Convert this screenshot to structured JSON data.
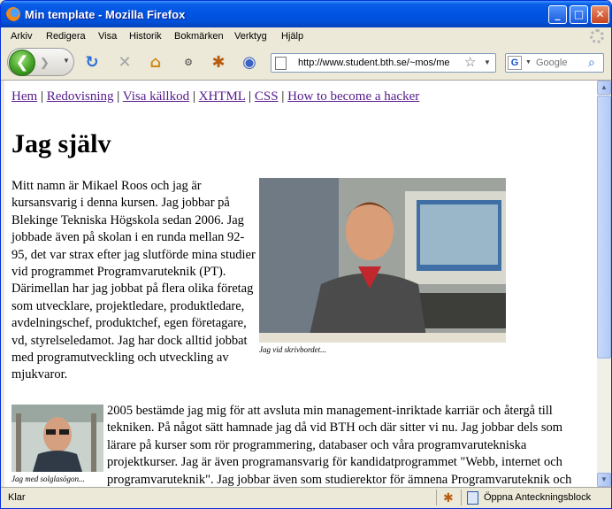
{
  "window": {
    "title": "Min template - Mozilla Firefox"
  },
  "menu": [
    "Arkiv",
    "Redigera",
    "Visa",
    "Historik",
    "Bokmärken",
    "Verktyg",
    "Hjälp"
  ],
  "url": "http://www.student.bth.se/~mos/me",
  "search": {
    "placeholder": "Google"
  },
  "page": {
    "nav": [
      "Hem",
      "Redovisning",
      "Visa källkod",
      "XHTML",
      "CSS",
      "How to become a hacker"
    ],
    "heading": "Jag själv",
    "para1": "Mitt namn är Mikael Roos och jag är kursansvarig i denna kursen. Jag jobbar på Blekinge Tekniska Högskola sedan 2006. Jag jobbade även på skolan i en runda mellan 92-95, det var strax efter jag slutförde mina studier vid programmet Programvaruteknik (PT). Därimellan har jag jobbat på flera olika företag som utvecklare, projektledare, produktledare, avdelningschef, produktchef, egen företagare, vd, styrelseledamot. Jag har dock alltid jobbat med programutveckling och utveckling av mjukvaror.",
    "caption1": "Jag vid skrivbordet...",
    "para2": "2005 bestämde jag mig för att avsluta min management-inriktade karriär och återgå till tekniken. På något sätt hamnade jag då vid BTH och där sitter vi nu. Jag jobbar dels som lärare på kurser som rör programmering, databaser och våra programvarutekniska projektkurser. Jag är även programansvarig för kandidatprogrammet \"Webb, internet och programvaruteknik\". Jag jobbar även som studierektor för ämnena Programvaruteknik och Datavetenskap där jag planerar våra kurser och besätte dem med lärare.",
    "caption2": "Jag med solglasögon..."
  },
  "status": {
    "text": "Klar",
    "note": "Öppna Anteckningsblock"
  }
}
